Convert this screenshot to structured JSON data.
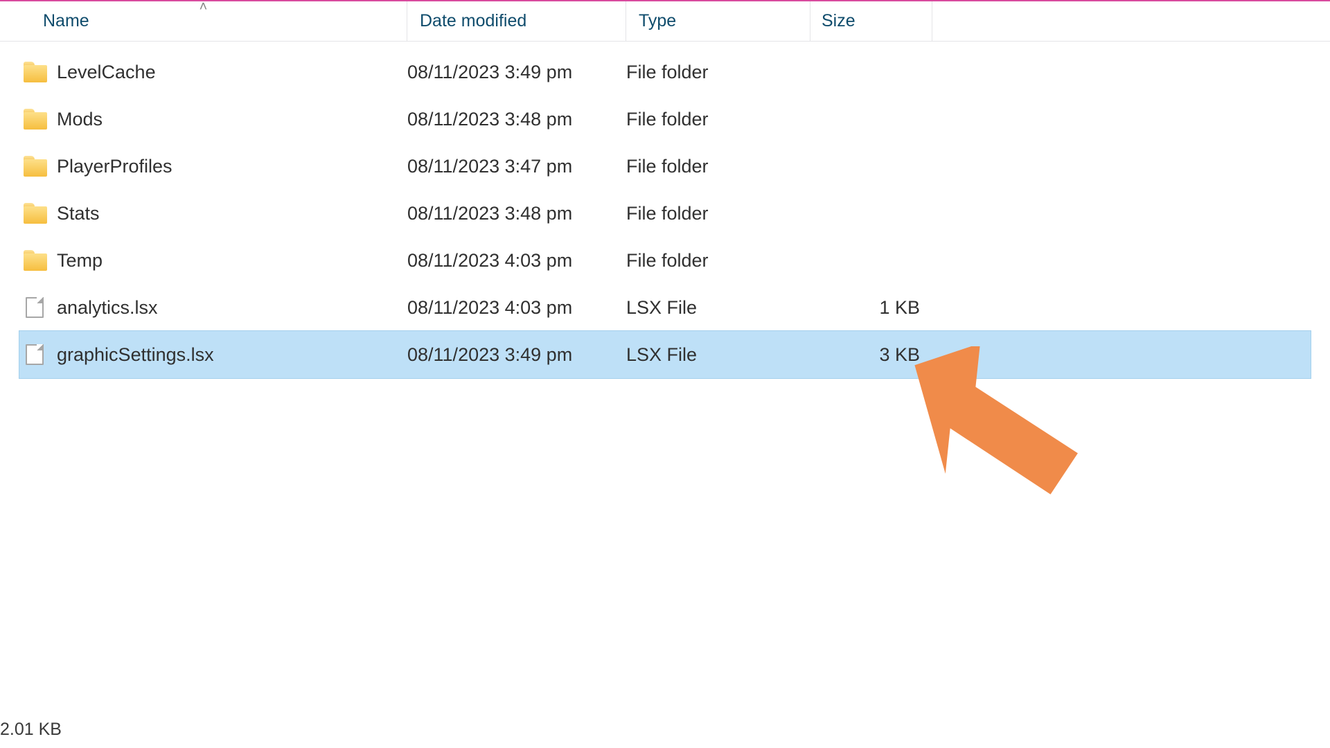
{
  "columns": {
    "name": "Name",
    "date": "Date modified",
    "type": "Type",
    "size": "Size"
  },
  "rows": [
    {
      "icon": "folder",
      "name": "LevelCache",
      "date": "08/11/2023 3:49 pm",
      "type": "File folder",
      "size": "",
      "selected": false
    },
    {
      "icon": "folder",
      "name": "Mods",
      "date": "08/11/2023 3:48 pm",
      "type": "File folder",
      "size": "",
      "selected": false
    },
    {
      "icon": "folder",
      "name": "PlayerProfiles",
      "date": "08/11/2023 3:47 pm",
      "type": "File folder",
      "size": "",
      "selected": false
    },
    {
      "icon": "folder",
      "name": "Stats",
      "date": "08/11/2023 3:48 pm",
      "type": "File folder",
      "size": "",
      "selected": false
    },
    {
      "icon": "folder",
      "name": "Temp",
      "date": "08/11/2023 4:03 pm",
      "type": "File folder",
      "size": "",
      "selected": false
    },
    {
      "icon": "file",
      "name": "analytics.lsx",
      "date": "08/11/2023 4:03 pm",
      "type": "LSX File",
      "size": "1 KB",
      "selected": false
    },
    {
      "icon": "file",
      "name": "graphicSettings.lsx",
      "date": "08/11/2023 3:49 pm",
      "type": "LSX File",
      "size": "3 KB",
      "selected": true
    }
  ],
  "status": "2.01 KB",
  "sort": {
    "column": "name",
    "direction": "asc",
    "glyph": "˄"
  }
}
